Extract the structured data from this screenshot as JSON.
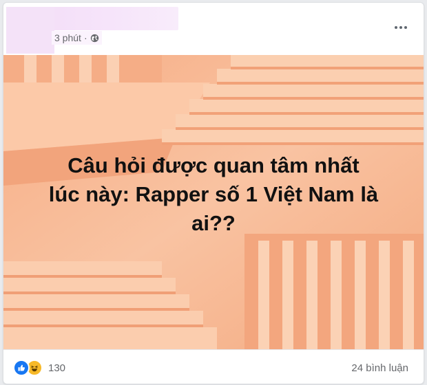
{
  "post": {
    "timestamp": "3 phút",
    "separator": "·",
    "privacy_icon": "globe-icon",
    "more_icon": "more-options-icon",
    "image_text": {
      "line1": "Câu hỏi được quan tâm nhất",
      "line2": "lúc này: Rapper số 1 Việt Nam là",
      "line3": "ai??"
    },
    "colors": {
      "image_background": "#f7b58f",
      "like_blue": "#1877f2",
      "haha_yellow": "#f7b928",
      "meta_gray": "#65676b"
    }
  },
  "footer": {
    "reaction_icons": [
      "like-icon",
      "haha-icon"
    ],
    "reaction_count": "130",
    "comments_label": "24 bình luận"
  }
}
